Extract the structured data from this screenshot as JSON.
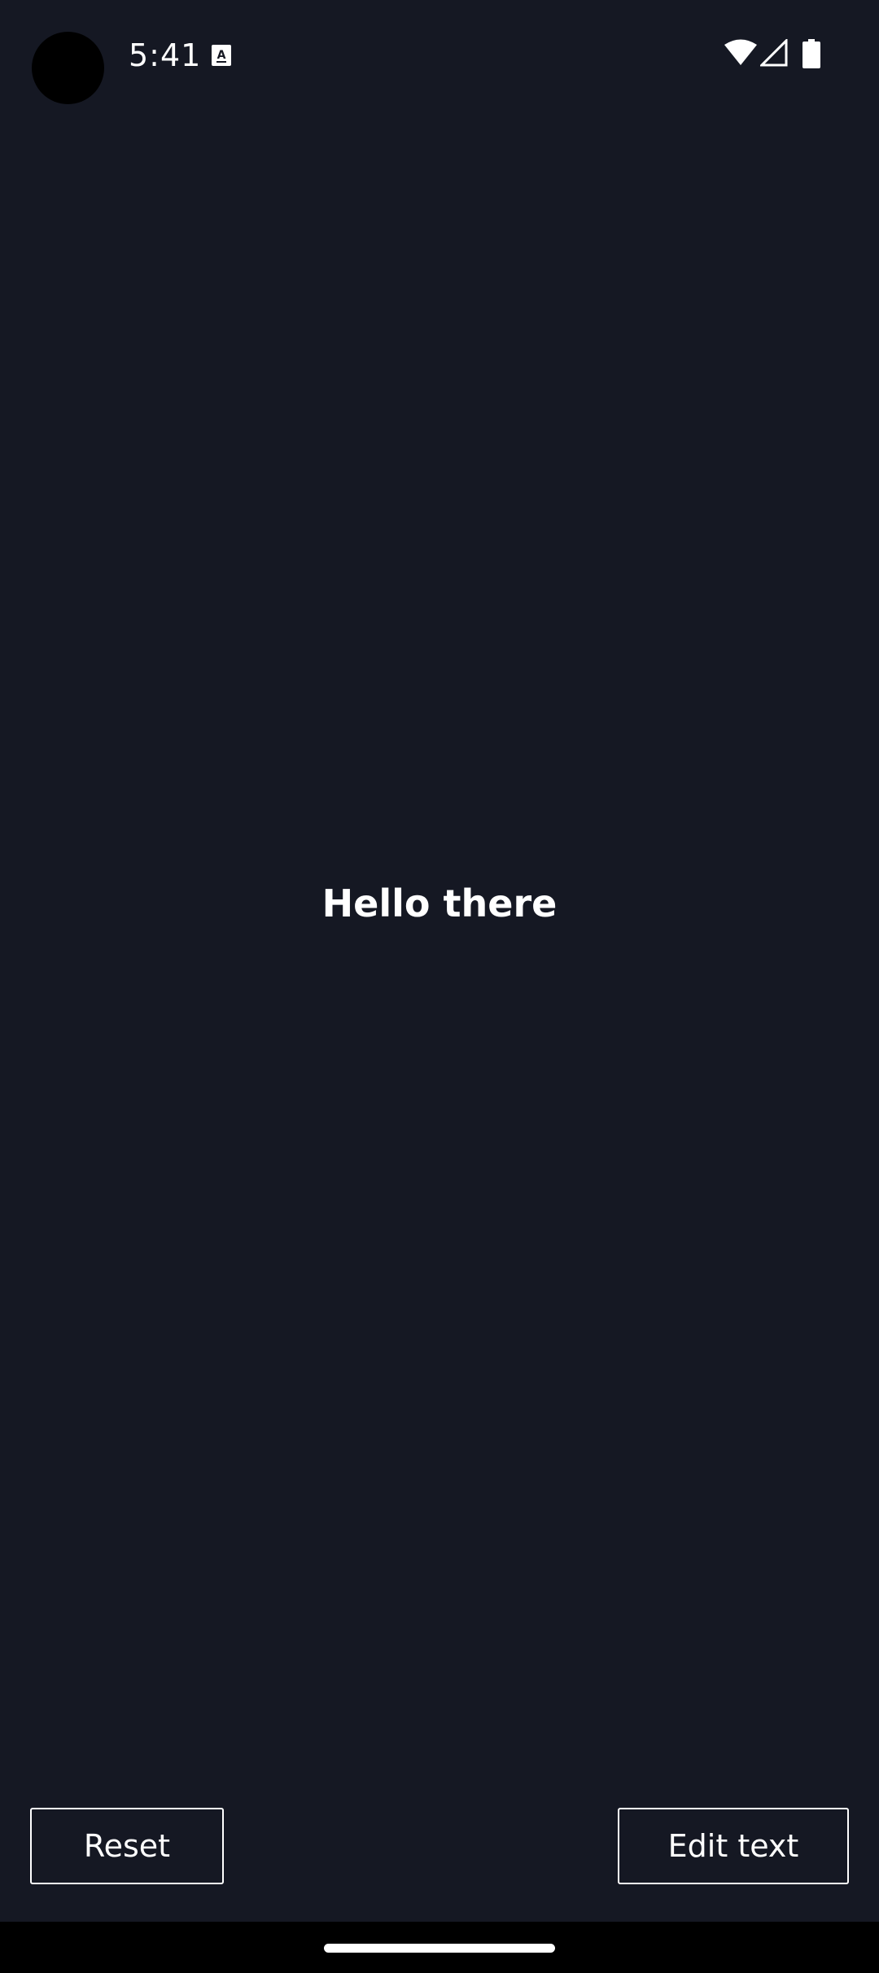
{
  "status_bar": {
    "time": "5:41",
    "notification_icon": "a-text-notification-icon",
    "icons": [
      "wifi-icon",
      "cellular-signal-icon",
      "battery-icon"
    ]
  },
  "main": {
    "greeting": "Hello there"
  },
  "buttons": {
    "reset_label": "Reset",
    "edit_label": "Edit text"
  },
  "colors": {
    "background": "#151823",
    "text": "#ffffff",
    "nav_bar": "#000000"
  }
}
